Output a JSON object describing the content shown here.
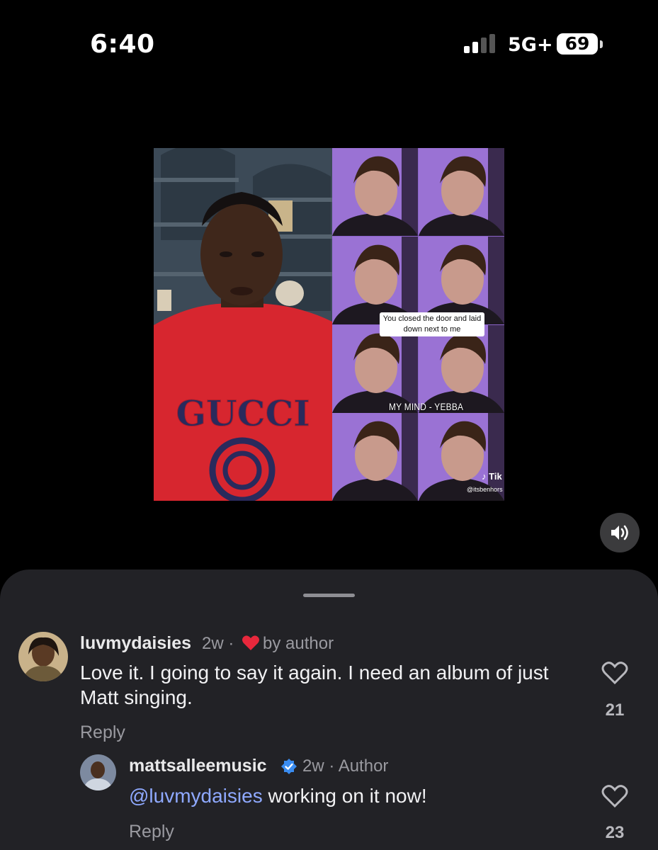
{
  "status_bar": {
    "time": "6:40",
    "network": "5G+",
    "battery": "69"
  },
  "video": {
    "caption": "You closed the door and laid down next to me",
    "song_label": "MY MIND - YEBBA",
    "watermark": "Tik",
    "handle": "@itsbenhors",
    "shirt_text": "GUCCI"
  },
  "controls": {
    "mute_icon": "speaker-icon"
  },
  "comments": [
    {
      "username": "luvmydaisies",
      "time": "2w",
      "separator": "·",
      "badge": "by author",
      "text": "Love it. I going to say it again. I need an album of just Matt singing.",
      "reply_label": "Reply",
      "likes": "21"
    },
    {
      "username": "mattsalleemusic",
      "time": "2w",
      "role": "· Author",
      "mention": "@luvmydaisies",
      "text": " working on it now!",
      "reply_label": "Reply",
      "likes": "23"
    }
  ],
  "colors": {
    "sheet_bg": "#222226",
    "heart_red": "#e8283c",
    "verified_blue": "#3a8cf0",
    "mention_blue": "#8fa9ff"
  }
}
